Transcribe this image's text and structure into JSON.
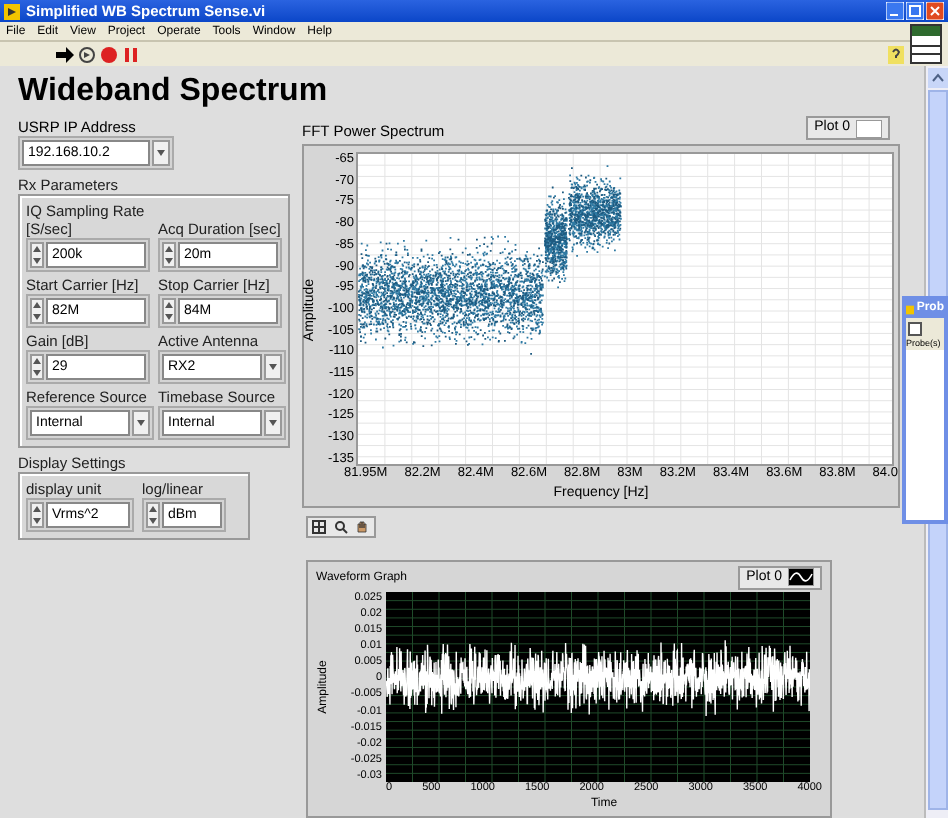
{
  "window": {
    "title": "Simplified WB Spectrum Sense.vi"
  },
  "menu": [
    "File",
    "Edit",
    "View",
    "Project",
    "Operate",
    "Tools",
    "Window",
    "Help"
  ],
  "panel": {
    "title": "Wideband Spectrum"
  },
  "usrp_ip": {
    "label": "USRP IP Address",
    "value": "192.168.10.2"
  },
  "rx_parameters": {
    "label": "Rx Parameters",
    "controls": [
      {
        "kind": "numeric",
        "label": "IQ Sampling Rate [S/sec]",
        "value": "200k"
      },
      {
        "kind": "numeric",
        "label": "Acq Duration [sec]",
        "value": "20m"
      },
      {
        "kind": "numeric",
        "label": "Start Carrier [Hz]",
        "value": "82M"
      },
      {
        "kind": "numeric",
        "label": "Stop Carrier [Hz]",
        "value": "84M"
      },
      {
        "kind": "numeric",
        "label": "Gain [dB]",
        "value": "29"
      },
      {
        "kind": "enum",
        "label": "Active Antenna",
        "value": "RX2"
      },
      {
        "kind": "enum",
        "label": "Reference Source",
        "value": "Internal"
      },
      {
        "kind": "enum",
        "label": "Timebase Source",
        "value": "Internal"
      }
    ]
  },
  "display_settings": {
    "label": "Display Settings",
    "controls": [
      {
        "kind": "numeric",
        "label": "display unit",
        "value": "Vrms^2"
      },
      {
        "kind": "numeric",
        "label": "log/linear",
        "value": "dBm"
      }
    ]
  },
  "fft_graph": {
    "title": "FFT Power Spectrum",
    "legend": "Plot 0",
    "ylabel": "Amplitude",
    "xlabel": "Frequency [Hz]",
    "y_ticks": [
      "-65",
      "-70",
      "-75",
      "-80",
      "-85",
      "-90",
      "-95",
      "-100",
      "-105",
      "-110",
      "-115",
      "-120",
      "-125",
      "-130",
      "-135"
    ],
    "x_ticks": [
      "81.95M",
      "82.2M",
      "82.4M",
      "82.6M",
      "82.8M",
      "83M",
      "83.2M",
      "83.4M",
      "83.6M",
      "83.8M",
      "84.0"
    ]
  },
  "waveform_graph": {
    "title": "Waveform Graph",
    "legend": "Plot 0",
    "ylabel": "Amplitude",
    "xlabel": "Time",
    "y_ticks": [
      "0.025",
      "0.02",
      "0.015",
      "0.01",
      "0.005",
      "0",
      "-0.005",
      "-0.01",
      "-0.015",
      "-0.02",
      "-0.025",
      "-0.03"
    ],
    "x_ticks": [
      "0",
      "500",
      "1000",
      "1500",
      "2000",
      "2500",
      "3000",
      "3500",
      "4000"
    ]
  },
  "probe_window": {
    "title": "Prob",
    "label": "Probe(s)"
  }
}
